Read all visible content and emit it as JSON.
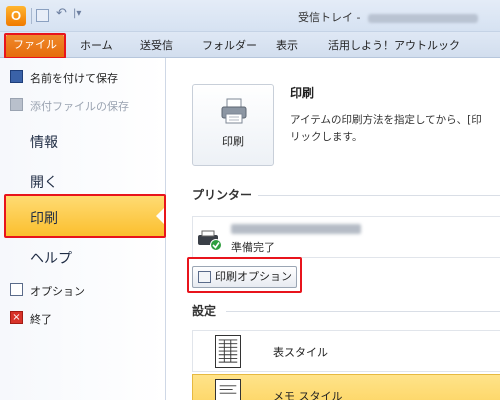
{
  "window": {
    "app_icon_letter": "O",
    "title_prefix": "受信トレイ - "
  },
  "tabs": {
    "file": "ファイル",
    "home": "ホーム",
    "send_receive": "送受信",
    "folder": "フォルダー",
    "view": "表示",
    "learn": "活用しよう！アウトルック"
  },
  "nav": {
    "save_as": "名前を付けて保存",
    "save_attachments": "添付ファイルの保存",
    "info": "情報",
    "open": "開く",
    "print": "印刷",
    "help": "ヘルプ",
    "options": "オプション",
    "exit": "終了"
  },
  "print_panel": {
    "button_label": "印刷",
    "heading": "印刷",
    "desc_line1": "アイテムの印刷方法を指定してから、[印",
    "desc_line2": "リックします。"
  },
  "printer": {
    "section_title": "プリンター",
    "status": "準備完了",
    "options_button": "印刷オプション"
  },
  "settings": {
    "section_title": "設定",
    "styles": [
      "表スタイル",
      "メモ スタイル"
    ]
  },
  "colors": {
    "file_tab": "#e56b0a",
    "selected_nav": "#fbbf2e",
    "highlight_frame": "#e8141c"
  },
  "icons": {
    "save_as": "save-as-icon",
    "save_attachments": "attachment-save-icon",
    "options": "options-icon",
    "exit": "exit-icon",
    "printer": "printer-icon",
    "print_options": "print-options-icon"
  }
}
